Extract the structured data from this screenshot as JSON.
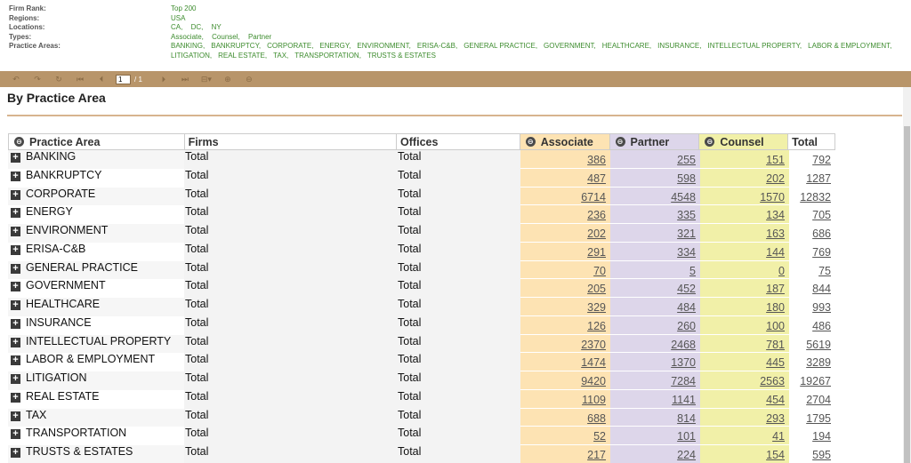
{
  "filters": {
    "firm_rank": {
      "label": "Firm Rank:",
      "values": [
        "Top 200"
      ]
    },
    "regions": {
      "label": "Regions:",
      "values": [
        "USA"
      ]
    },
    "locations": {
      "label": "Locations:",
      "values": [
        "CA,",
        "DC,",
        "NY"
      ]
    },
    "types": {
      "label": "Types:",
      "values": [
        "Associate,",
        "Counsel,",
        "Partner"
      ]
    },
    "practice_areas": {
      "label": "Practice Areas:",
      "line1": [
        "BANKING,",
        "BANKRUPTCY,",
        "CORPORATE,",
        "ENERGY,",
        "ENVIRONMENT,",
        "ERISA-C&B,",
        "GENERAL PRACTICE,",
        "GOVERNMENT,",
        "HEALTHCARE,",
        "INSURANCE,",
        "INTELLECTUAL PROPERTY,",
        "LABOR & EMPLOYMENT,"
      ],
      "line2": [
        "LITIGATION,",
        "REAL ESTATE,",
        "TAX,",
        "TRANSPORTATION,",
        "TRUSTS & ESTATES"
      ]
    }
  },
  "toolbar": {
    "page_current": "1",
    "page_total": "/ 1",
    "icons": [
      "undo-icon",
      "redo-icon",
      "refresh-icon",
      "first-page-icon",
      "prev-page-icon",
      "next-page-icon",
      "last-page-icon",
      "export-icon",
      "zoom-in-icon",
      "zoom-out-icon"
    ]
  },
  "report": {
    "title": "By Practice Area",
    "columns": {
      "practice_area": "Practice Area",
      "firms": "Firms",
      "offices": "Offices",
      "associate": "Associate",
      "partner": "Partner",
      "counsel": "Counsel",
      "total": "Total"
    },
    "rows": [
      {
        "area": "BANKING",
        "firms": "Total",
        "offices": "Total",
        "associate": "386",
        "partner": "255",
        "counsel": "151",
        "total": "792"
      },
      {
        "area": "BANKRUPTCY",
        "firms": "Total",
        "offices": "Total",
        "associate": "487",
        "partner": "598",
        "counsel": "202",
        "total": "1287"
      },
      {
        "area": "CORPORATE",
        "firms": "Total",
        "offices": "Total",
        "associate": "6714",
        "partner": "4548",
        "counsel": "1570",
        "total": "12832"
      },
      {
        "area": "ENERGY",
        "firms": "Total",
        "offices": "Total",
        "associate": "236",
        "partner": "335",
        "counsel": "134",
        "total": "705"
      },
      {
        "area": "ENVIRONMENT",
        "firms": "Total",
        "offices": "Total",
        "associate": "202",
        "partner": "321",
        "counsel": "163",
        "total": "686"
      },
      {
        "area": "ERISA-C&B",
        "firms": "Total",
        "offices": "Total",
        "associate": "291",
        "partner": "334",
        "counsel": "144",
        "total": "769"
      },
      {
        "area": "GENERAL PRACTICE",
        "firms": "Total",
        "offices": "Total",
        "associate": "70",
        "partner": "5",
        "counsel": "0",
        "total": "75"
      },
      {
        "area": "GOVERNMENT",
        "firms": "Total",
        "offices": "Total",
        "associate": "205",
        "partner": "452",
        "counsel": "187",
        "total": "844"
      },
      {
        "area": "HEALTHCARE",
        "firms": "Total",
        "offices": "Total",
        "associate": "329",
        "partner": "484",
        "counsel": "180",
        "total": "993"
      },
      {
        "area": "INSURANCE",
        "firms": "Total",
        "offices": "Total",
        "associate": "126",
        "partner": "260",
        "counsel": "100",
        "total": "486"
      },
      {
        "area": "INTELLECTUAL PROPERTY",
        "firms": "Total",
        "offices": "Total",
        "associate": "2370",
        "partner": "2468",
        "counsel": "781",
        "total": "5619"
      },
      {
        "area": "LABOR & EMPLOYMENT",
        "firms": "Total",
        "offices": "Total",
        "associate": "1474",
        "partner": "1370",
        "counsel": "445",
        "total": "3289"
      },
      {
        "area": "LITIGATION",
        "firms": "Total",
        "offices": "Total",
        "associate": "9420",
        "partner": "7284",
        "counsel": "2563",
        "total": "19267"
      },
      {
        "area": "REAL ESTATE",
        "firms": "Total",
        "offices": "Total",
        "associate": "1109",
        "partner": "1141",
        "counsel": "454",
        "total": "2704"
      },
      {
        "area": "TAX",
        "firms": "Total",
        "offices": "Total",
        "associate": "688",
        "partner": "814",
        "counsel": "293",
        "total": "1795"
      },
      {
        "area": "TRANSPORTATION",
        "firms": "Total",
        "offices": "Total",
        "associate": "52",
        "partner": "101",
        "counsel": "41",
        "total": "194"
      },
      {
        "area": "TRUSTS & ESTATES",
        "firms": "Total",
        "offices": "Total",
        "associate": "217",
        "partner": "224",
        "counsel": "154",
        "total": "595"
      }
    ]
  },
  "colors": {
    "toolbar": "#b8956a",
    "associate": "#fde3b3",
    "partner": "#ddd6ea",
    "counsel": "#f1f0a8",
    "filter_value": "#3d8c2e"
  }
}
